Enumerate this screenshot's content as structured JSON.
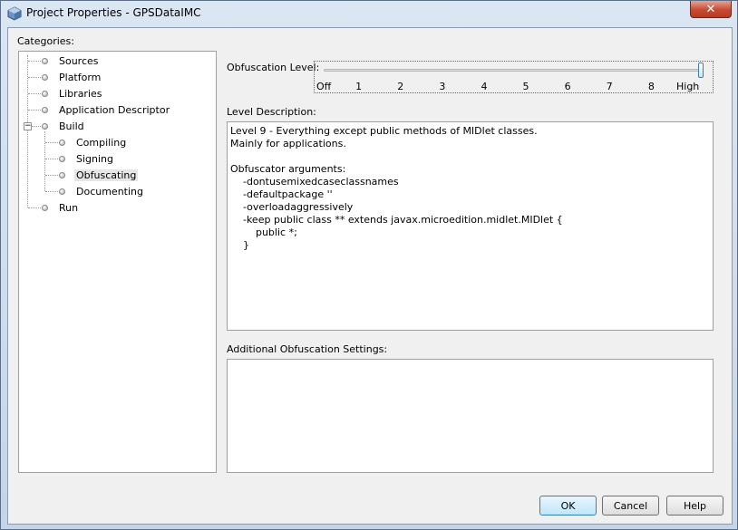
{
  "window": {
    "title": "Project Properties - GPSDataIMC",
    "close_label": "✕"
  },
  "categories": {
    "label": "Categories:",
    "items": [
      {
        "label": "Sources"
      },
      {
        "label": "Platform"
      },
      {
        "label": "Libraries"
      },
      {
        "label": "Application Descriptor"
      },
      {
        "label": "Build",
        "expanded": true,
        "expander": "−"
      },
      {
        "label": "Compiling"
      },
      {
        "label": "Signing"
      },
      {
        "label": "Obfuscating",
        "selected": true
      },
      {
        "label": "Documenting"
      },
      {
        "label": "Run"
      }
    ]
  },
  "obfuscation": {
    "level_label": "Obfuscation Level:",
    "level_value": 9,
    "level_max": 9,
    "ticks": [
      "Off",
      "1",
      "2",
      "3",
      "4",
      "5",
      "6",
      "7",
      "8",
      "High"
    ],
    "description_label": "Level Description:",
    "description_text": "Level 9 - Everything except public methods of MIDlet classes.\nMainly for applications.\n\nObfuscator arguments:\n    -dontusemixedcaseclassnames\n    -defaultpackage ''\n    -overloadaggressively\n    -keep public class ** extends javax.microedition.midlet.MIDlet {\n        public *;\n    }",
    "additional_label": "Additional Obfuscation Settings:",
    "additional_value": ""
  },
  "buttons": {
    "ok": "OK",
    "cancel": "Cancel",
    "help": "Help"
  }
}
